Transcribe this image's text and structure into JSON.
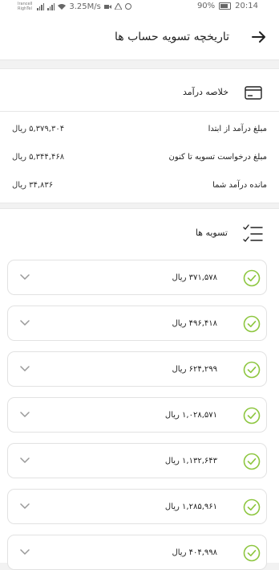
{
  "status_bar": {
    "carrier_line1": "Irancell",
    "carrier_line2": "RighTel",
    "speed": "3.25M/s",
    "battery": "90%",
    "time": "20:14"
  },
  "header": {
    "title": "تاریخچه تسویه حساب ها",
    "back_icon": "arrow-right-icon"
  },
  "summary": {
    "title": "خلاصه درآمد",
    "icon": "wallet-icon",
    "rows": [
      {
        "label": "مبلغ درآمد از ابتدا",
        "value": "۵,۳۷۹,۳۰۴ ریال"
      },
      {
        "label": "مبلغ درخواست تسویه تا کنون",
        "value": "۵,۳۴۴,۴۶۸ ریال"
      },
      {
        "label": "مانده درآمد شما",
        "value": "۳۴,۸۳۶ ریال"
      }
    ]
  },
  "settlements": {
    "title": "تسویه ها",
    "icon": "checklist-icon",
    "accent_color": "#8dc63f",
    "items": [
      {
        "amount": "۳۷۱,۵۷۸ ریال"
      },
      {
        "amount": "۴۹۶,۴۱۸ ریال"
      },
      {
        "amount": "۶۲۴,۲۹۹ ریال"
      },
      {
        "amount": "۱,۰۲۸,۵۷۱ ریال"
      },
      {
        "amount": "۱,۱۳۲,۶۴۳ ریال"
      },
      {
        "amount": "۱,۲۸۵,۹۶۱ ریال"
      },
      {
        "amount": "۴۰۴,۹۹۸ ریال"
      }
    ]
  }
}
